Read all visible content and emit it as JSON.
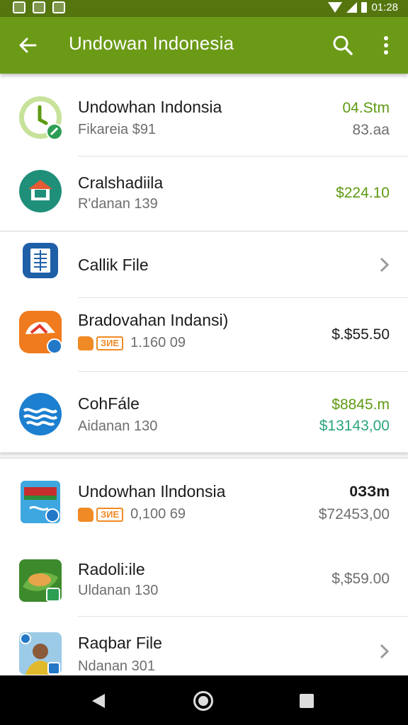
{
  "status_bar": {
    "time": "01:28"
  },
  "app_bar": {
    "title": "Undowan Indonesia"
  },
  "colors": {
    "app_bar": "#6b9a17",
    "status_bar": "#55760f",
    "value_green": "#5d9a12",
    "value_teal": "#2aa57f",
    "tag_orange": "#f08a24"
  },
  "items": [
    {
      "title": "Undowhan Indonsia",
      "subtitle": "Fikareia $91",
      "value": "04.Stm",
      "value2": "83.aa",
      "icon": "clock-app-icon"
    },
    {
      "title": "Cralshadiila",
      "subtitle": "R'danan 139",
      "value": "$224.10",
      "icon": "house-app-icon"
    },
    {
      "title": "Callik File",
      "icon": "document-app-icon",
      "chevron": "chevron-right-icon"
    },
    {
      "title": "Bradovahan Indansi)",
      "tag": "ЗИЕ",
      "subtitle": "1.160 09",
      "value": "$.$55.50",
      "icon": "umbrella-app-icon"
    },
    {
      "title": "CohFále",
      "subtitle": "Aidanan 130",
      "value": "$8845.m",
      "value2": "$13143,00",
      "icon": "waves-app-icon"
    },
    {
      "title": "Undowhan Ilndonsia",
      "tag": "ЗИЕ",
      "subtitle": "0,100 69",
      "value": "0ЗЗm",
      "value2": "$7245З,00",
      "icon": "flag-photo-icon"
    },
    {
      "title": "Radoli:ile",
      "subtitle": "Uldanan 130",
      "value": "$,$59.00",
      "icon": "food-photo-icon"
    },
    {
      "title": "Raqbar File",
      "subtitle": "Ndanan 301",
      "icon": "person-photo-icon",
      "chevron": "chevron-right-icon"
    }
  ]
}
